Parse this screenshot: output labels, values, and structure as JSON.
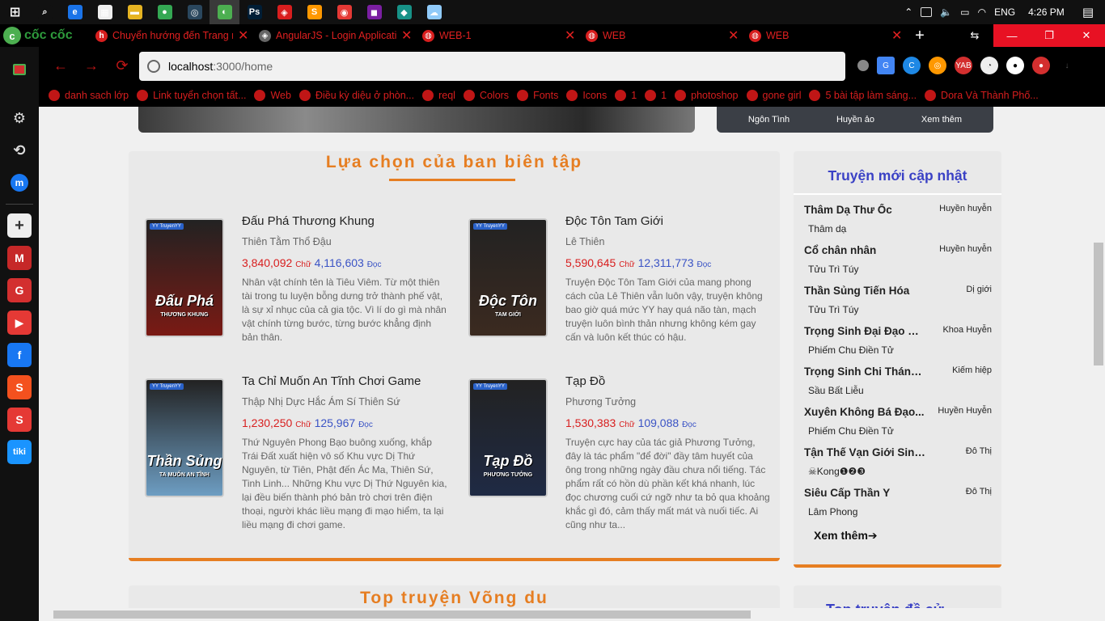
{
  "taskbar": {
    "time": "4:26 PM",
    "lang": "ENG",
    "apps": [
      {
        "name": "search-icon",
        "color": "#111",
        "glyph": "⌕"
      },
      {
        "name": "edge-icon",
        "color": "#1a73e8",
        "glyph": "e"
      },
      {
        "name": "store-icon",
        "color": "#eee",
        "glyph": "▦"
      },
      {
        "name": "folder-icon",
        "color": "#e6b422",
        "glyph": "▬"
      },
      {
        "name": "chrome-icon",
        "color": "#34a853",
        "glyph": "●"
      },
      {
        "name": "steam-icon",
        "color": "#2a475e",
        "glyph": "◎"
      },
      {
        "name": "coccoc-icon",
        "color": "#4caf50",
        "glyph": "◐"
      },
      {
        "name": "photoshop-icon",
        "color": "#001e36",
        "glyph": "Ps"
      },
      {
        "name": "garena-icon",
        "color": "#d81e1e",
        "glyph": "◈"
      },
      {
        "name": "sublime-icon",
        "color": "#ff9800",
        "glyph": "S"
      },
      {
        "name": "app-red-icon",
        "color": "#e53935",
        "glyph": "◉"
      },
      {
        "name": "app-purple-icon",
        "color": "#7b1fa2",
        "glyph": "◼"
      },
      {
        "name": "gitkraken-icon",
        "color": "#179287",
        "glyph": "◆"
      },
      {
        "name": "app-cloud-icon",
        "color": "#90caf9",
        "glyph": "☁"
      }
    ]
  },
  "browser": {
    "brand": "cốc cốc",
    "url_host": "localhost",
    "url_rest": ":3000/home",
    "tabs": [
      {
        "title": "Chuyển hướng đến Trang n",
        "fav": "h",
        "color": "#d81e1e"
      },
      {
        "title": "AngularJS - Login Applicatio",
        "fav": "◈",
        "color": "#666"
      },
      {
        "title": "WEB-1",
        "fav": "◍",
        "color": "#d81e1e"
      },
      {
        "title": "WEB",
        "fav": "◍",
        "color": "#d81e1e"
      },
      {
        "title": "WEB",
        "fav": "◍",
        "color": "#d81e1e"
      }
    ],
    "bookmarks": [
      "danh sach lớp",
      "Link tuyển chọn tất...",
      "Web",
      "Điều kỳ diệu ở phòn...",
      "reql",
      "Colors",
      "Fonts",
      "Icons",
      "1",
      "1",
      "photoshop",
      "gone girl",
      "5 bài tập làm sáng...",
      "Dora Và Thành Phố..."
    ]
  },
  "genres": [
    "Ngôn Tình",
    "Huyền ảo",
    "Xem thêm"
  ],
  "editor": {
    "title": "Lựa chọn của ban biên tập",
    "read_unit": "Đọc",
    "word_unit": "Chữ",
    "books": [
      {
        "title": "Đấu Phá Thương Khung",
        "author": "Thiên Tằm Thổ Đậu",
        "words": "3,840,092",
        "reads": "4,116,603",
        "desc": "Nhân vật chính tên là Tiêu Viêm. Từ một thiên tài trong tu luyện bỗng dưng trở thành phế vật, là sự xỉ nhục của cả gia tộc. Vì lí do gì mà nhân vật chính từng bước, từng bước khẳng định bản thân.",
        "cover_text": "Đấu Phá",
        "cover_sub": "THƯƠNG KHUNG",
        "cover_color": "#7a1a14"
      },
      {
        "title": "Độc Tôn Tam Giới",
        "author": "Lê Thiên",
        "words": "5,590,645",
        "reads": "12,311,773",
        "desc": "Truyện Độc Tôn Tam Giới của mang phong cách của Lê Thiên vẫn luôn vậy, truyện không bao giờ quá mức YY hay quá não tàn, mạch truyện luôn bình thản nhưng không kém gay cấn và luôn kết thúc có hậu.",
        "cover_text": "Độc Tôn",
        "cover_sub": "TAM GIỚI",
        "cover_color": "#3b2a20"
      },
      {
        "title": "Ta Chỉ Muốn An Tĩnh Chơi Game",
        "author": "Thập Nhị Dực Hắc Ám Sí Thiên Sứ",
        "words": "1,230,250",
        "reads": "125,967",
        "desc": "Thứ Nguyên Phong Bạo buông xuống, khắp Trái Đất xuất hiện vô số Khu vực Dị Thứ Nguyên, từ Tiên, Phật đến Ác Ma, Thiên Sứ, Tinh Linh... Những Khu vực Dị Thứ Nguyên kia, lại đều biến thành phó bản trò chơi trên điện thoại, người khác liều mạng đi mạo hiểm, ta lại liều mạng đi chơi game.",
        "cover_text": "Thần Sủng",
        "cover_sub": "TA MUỐN AN TĨNH",
        "cover_color": "#6d9dc2"
      },
      {
        "title": "Tạp Đồ",
        "author": "Phương Tưởng",
        "words": "1,530,383",
        "reads": "109,088",
        "desc": "Truyện cực hay của tác giả Phương Tưởng, đây là tác phẩm \"để đời\" đầy tâm huyết của ông trong những ngày đầu chưa nổi tiếng. Tác phẩm rất có hồn dù phần kết khá nhanh, lúc đọc chương cuối cứ ngỡ như ta bỏ qua khoảng khắc gì đó, cảm thấy mất mát và nuối tiếc. Ai cũng như ta...",
        "cover_text": "Tạp Đồ",
        "cover_sub": "PHƯƠNG TƯỞNG",
        "cover_color": "#1f2a44"
      }
    ]
  },
  "new_updates": {
    "title": "Truyện mới cập nhật",
    "more": "Xem thêm➔",
    "items": [
      {
        "name": "Thâm Dạ Thư Ốc",
        "genre": "Huyền huyễn",
        "author": "Thâm dạ"
      },
      {
        "name": "Cổ chân nhân",
        "genre": "Huyền huyễn",
        "author": "Tửu Trì Túy"
      },
      {
        "name": "Thần Sủng Tiến Hóa",
        "genre": "Dị giới",
        "author": "Tửu Trì Túy"
      },
      {
        "name": "Trọng Sinh Đại Đạo Tặc",
        "genre": "Khoa Huyễn",
        "author": "Phiếm Chu Điền Tử"
      },
      {
        "name": "Trọng Sinh Chi Thánh...",
        "genre": "Kiếm hiệp",
        "author": "Sầu Bất Liễu"
      },
      {
        "name": "Xuyên Không Bá Đạo...",
        "genre": "Huyền Huyễn",
        "author": "Phiếm Chu Điền Tử"
      },
      {
        "name": "Tận Thế Vạn Giới Sinh...",
        "genre": "Đô Thị",
        "author": "☠Kong❶❷❸"
      },
      {
        "name": "Siêu Cấp Thần Y",
        "genre": "Đô Thị",
        "author": "Lâm Phong"
      }
    ]
  },
  "section2": {
    "title": "Top truyện Võng du"
  },
  "section3": {
    "title": "Top truyện đề cử"
  }
}
